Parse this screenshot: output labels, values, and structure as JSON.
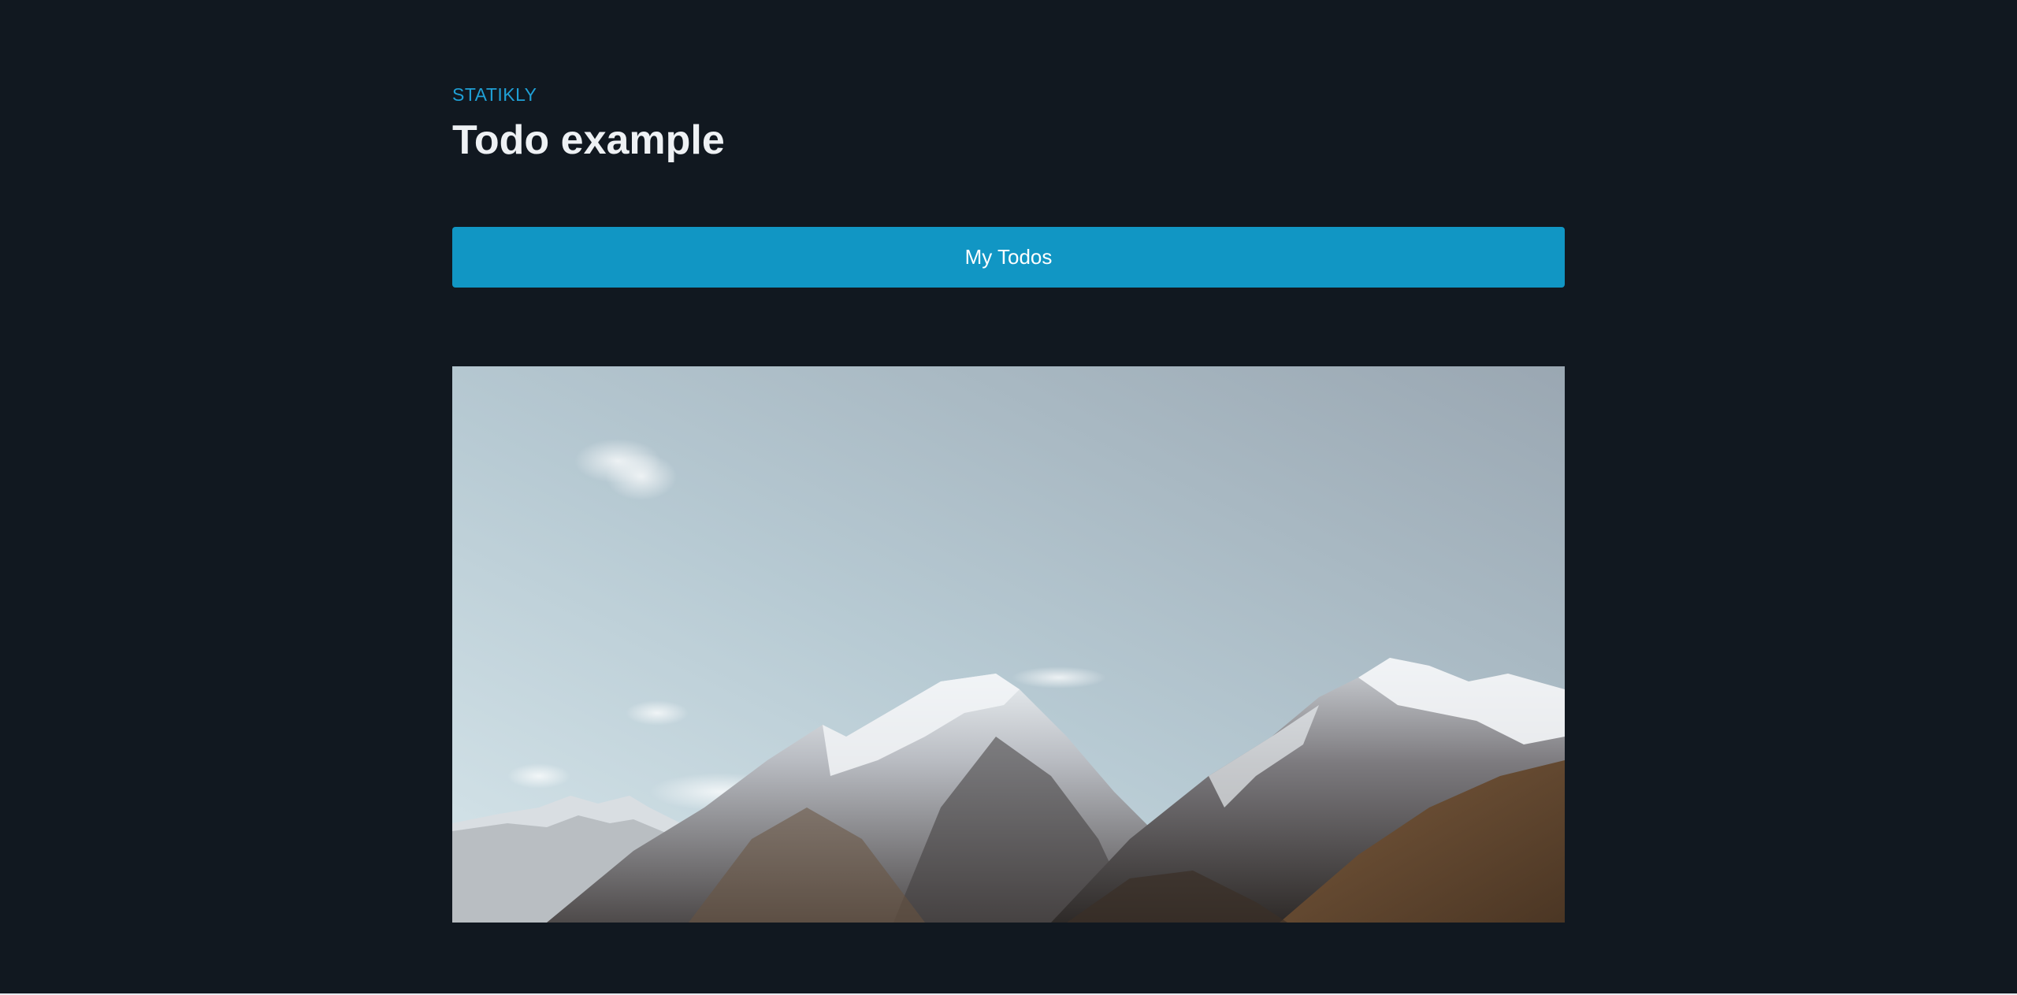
{
  "header": {
    "eyebrow": "STATIKLY",
    "title": "Todo example"
  },
  "actions": {
    "primary_label": "My Todos"
  },
  "hero": {
    "subject": "snow-capped mountain range under an overcast sky",
    "colors": {
      "sky_light": "#cfe0e6",
      "sky_dark": "#9aa9b4",
      "snow": "#eef2f4",
      "rock": "#5d5a5c",
      "earth": "#8a6a49"
    }
  },
  "theme": {
    "background": "#111820",
    "accent": "#1196c4",
    "eyebrow_color": "#1fa0d6",
    "title_color": "#eef1f4"
  }
}
